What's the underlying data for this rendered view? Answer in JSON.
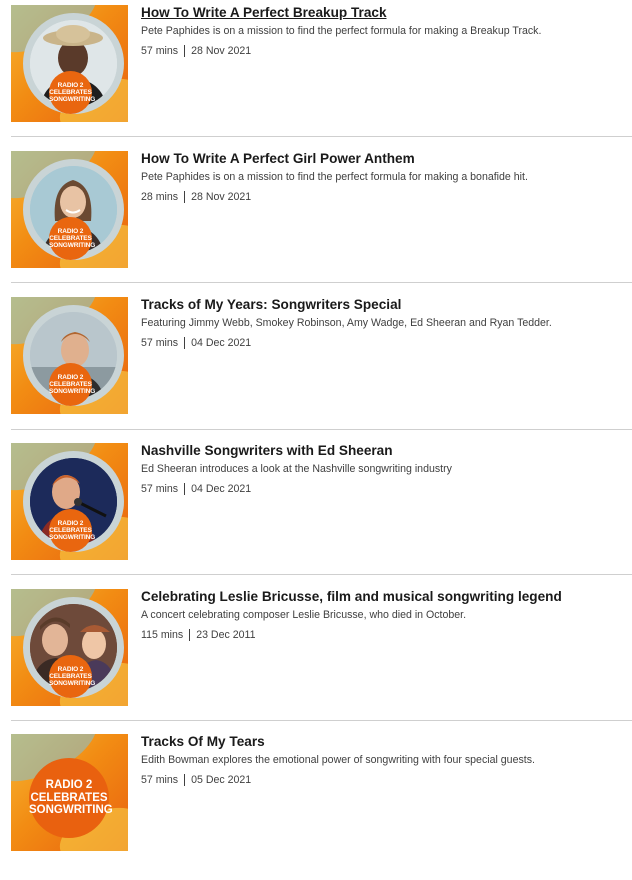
{
  "badge": {
    "line1": "RADIO 2",
    "line2": "CELEBRATES",
    "line3": "SONGWRITING"
  },
  "episodes": [
    {
      "title": "How To Write A Perfect Breakup Track",
      "description": "Pete Paphides is on a mission to find the perfect formula for making a Breakup Track.",
      "duration": "57 mins",
      "date": "28 Nov 2021",
      "image": "woman-in-hat-photo"
    },
    {
      "title": "How To Write A Perfect Girl Power Anthem",
      "description": "Pete Paphides is on a mission to find the perfect formula for making a bonafide hit.",
      "duration": "28 mins",
      "date": "28 Nov 2021",
      "image": "smiling-woman-photo"
    },
    {
      "title": "Tracks of My Years: Songwriters Special",
      "description": "Featuring Jimmy Webb, Smokey Robinson, Amy Wadge, Ed Sheeran and Ryan Tedder.",
      "duration": "57 mins",
      "date": "04 Dec 2021",
      "image": "man-portrait-photo"
    },
    {
      "title": "Nashville Songwriters with Ed Sheeran",
      "description": "Ed Sheeran introduces a look at the Nashville songwriting industry",
      "duration": "57 mins",
      "date": "04 Dec 2021",
      "image": "singer-at-microphone-photo"
    },
    {
      "title": "Celebrating Leslie Bricusse, film and musical songwriting legend",
      "description": "A concert celebrating composer Leslie Bricusse, who died in October.",
      "duration": "115 mins",
      "date": "23 Dec 2011",
      "image": "film-still-photo"
    },
    {
      "title": "Tracks Of My Tears",
      "description": "Edith Bowman explores the emotional power of songwriting with four special guests.",
      "duration": "57 mins",
      "date": "05 Dec 2021",
      "image": "radio2-logo"
    }
  ],
  "colors": {
    "brand_orange": "#e9660f",
    "ring": "#c9d4d6",
    "divider": "#cfcfcf"
  }
}
